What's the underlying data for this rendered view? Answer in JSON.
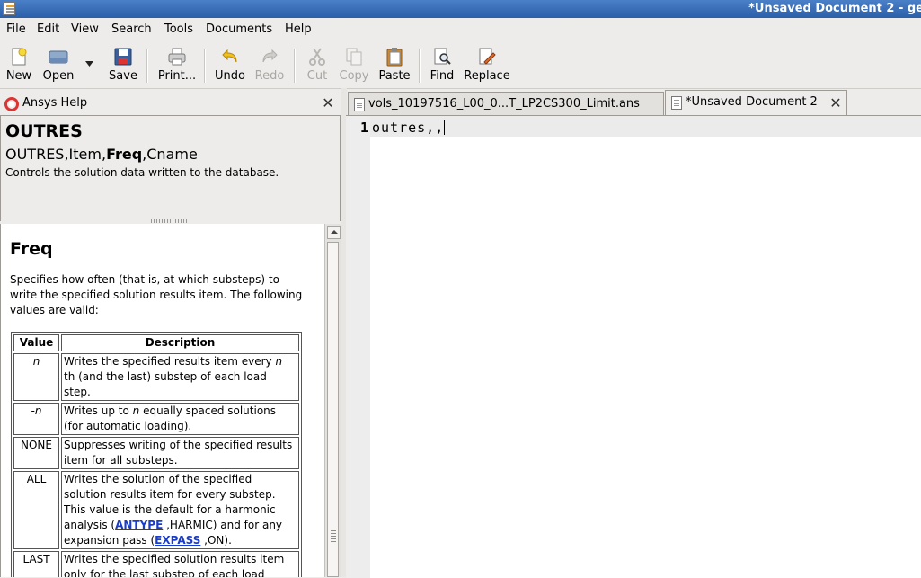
{
  "window": {
    "title": "*Unsaved Document 2 - ge"
  },
  "menu": [
    "File",
    "Edit",
    "View",
    "Search",
    "Tools",
    "Documents",
    "Help"
  ],
  "toolbar": {
    "new": "New",
    "open": "Open",
    "save": "Save",
    "print": "Print...",
    "undo": "Undo",
    "redo": "Redo",
    "cut": "Cut",
    "copy": "Copy",
    "paste": "Paste",
    "find": "Find",
    "replace": "Replace"
  },
  "help_pane": {
    "header": "Ansys Help",
    "command": "OUTRES",
    "syntax_a": "OUTRES,Item,",
    "syntax_b": "Freq",
    "syntax_c": ",Cname",
    "summary": "Controls the solution data written to the database.",
    "heading": "Freq",
    "paragraph": "Specifies how often (that is, at which substeps) to write the specified solution results item. The following values are valid:",
    "table": {
      "headers": [
        "Value",
        "Description"
      ],
      "rows": [
        {
          "value": "n",
          "desc_a": "Writes the specified results item every ",
          "desc_em": "n",
          "desc_b": " th (and the last) substep of each load step."
        },
        {
          "value": "-n",
          "desc_a": "Writes up to ",
          "desc_em": "n",
          "desc_b": "  equally spaced solutions (for automatic loading)."
        },
        {
          "value": "NONE",
          "desc": "Suppresses writing of the specified results item for all substeps."
        },
        {
          "value": "ALL",
          "desc_a": "Writes the solution of the specified solution results item for every substep. This value is the default for a harmonic analysis (",
          "link1": "ANTYPE",
          "desc_b": " ,HARMIC) and for any expansion pass (",
          "link2": "EXPASS",
          "desc_c": " ,ON)."
        },
        {
          "value": "LAST",
          "desc": "Writes the specified solution results item only for the last substep of each load"
        }
      ]
    }
  },
  "tabs": [
    {
      "label": "vols_10197516_L00_0...T_LP2CS300_Limit.ans",
      "active": false
    },
    {
      "label": "*Unsaved Document 2",
      "active": true
    }
  ],
  "editor": {
    "line_number": "1",
    "text": "outres,,"
  }
}
